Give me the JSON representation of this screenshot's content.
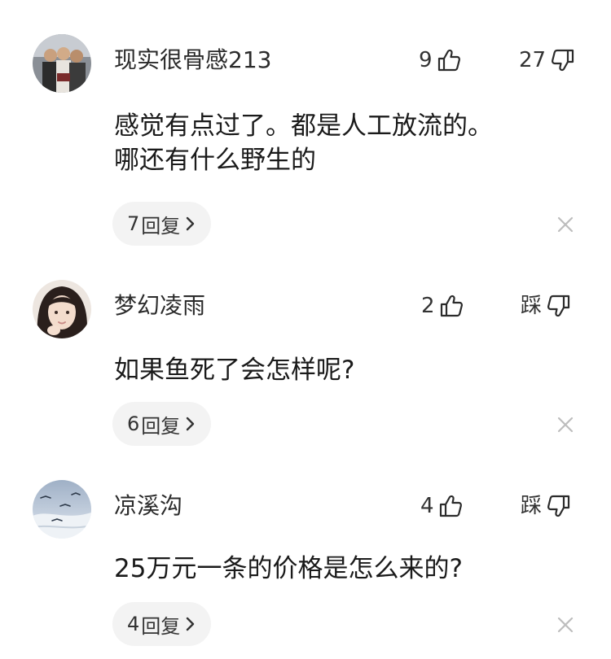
{
  "comments": [
    {
      "username": "现实很骨感213",
      "text_lines": [
        "感觉有点过了。都是人工放流的。",
        "哪还有什么野生的"
      ],
      "likes": "9",
      "dislike_label": "27",
      "reply_count": "7",
      "reply_label": "回复"
    },
    {
      "username": "梦幻凌雨",
      "text_lines": [
        "如果鱼死了会怎样呢?"
      ],
      "likes": "2",
      "dislike_label": "踩",
      "reply_count": "6",
      "reply_label": "回复"
    },
    {
      "username": "凉溪沟",
      "text_lines": [
        "25万元一条的价格是怎么来的?"
      ],
      "likes": "4",
      "dislike_label": "踩",
      "reply_count": "4",
      "reply_label": "回复"
    }
  ],
  "icons": {
    "like": "thumbs-up-icon",
    "dislike": "thumbs-down-icon",
    "reply_more": "chevron-right-icon",
    "dismiss": "close-icon"
  },
  "colors": {
    "pill_background": "#f3f3f3",
    "icon_gray": "#bdbdbd",
    "text": "#1a1a1a"
  }
}
